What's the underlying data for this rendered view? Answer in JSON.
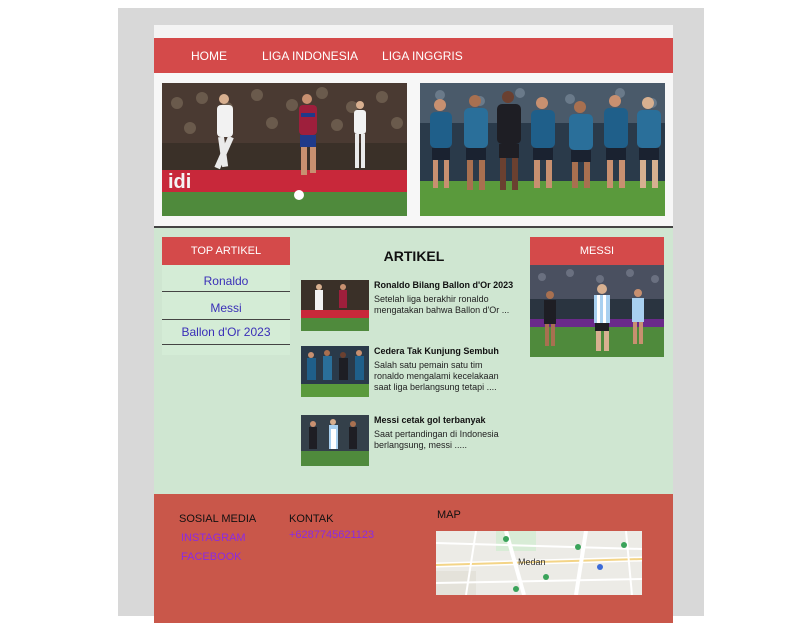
{
  "nav": {
    "items": [
      "HOME",
      "LIGA INDONESIA",
      "LIGA INGGRIS"
    ]
  },
  "sidebar": {
    "title": "TOP ARTIKEL",
    "links": [
      "Ronaldo",
      "Messi",
      "Ballon d'Or 2023"
    ]
  },
  "main": {
    "title": "ARTIKEL",
    "articles": [
      {
        "title": "Ronaldo Bilang Ballon d'Or 2023",
        "body": [
          "Setelah liga berakhir ronaldo",
          "mengatakan bahwa Ballon d'Or ..."
        ]
      },
      {
        "title": "Cedera Tak Kunjung Sembuh",
        "body": [
          "Salah satu pemain satu tim",
          "ronaldo mengalami kecelakaan",
          "saat liga berlangsung tetapi ...."
        ]
      },
      {
        "title": "Messi cetak gol terbanyak",
        "body": [
          "Saat pertandingan di Indonesia",
          "berlangsung, messi ....."
        ]
      }
    ]
  },
  "right": {
    "title": "MESSI"
  },
  "footer": {
    "social_title": "SOSIAL MEDIA",
    "social_links": [
      "INSTAGRAM",
      "FACEBOOK"
    ],
    "contact_title": "KONTAK",
    "phone": "+6287745621123",
    "map_title": "MAP",
    "map_city": "Medan"
  },
  "colors": {
    "accent": "#d44a4a",
    "page_bg": "#cfe6d1",
    "footer_bg": "#c9574a",
    "link": "#3a2fb8",
    "footer_link": "#8a2be2"
  }
}
